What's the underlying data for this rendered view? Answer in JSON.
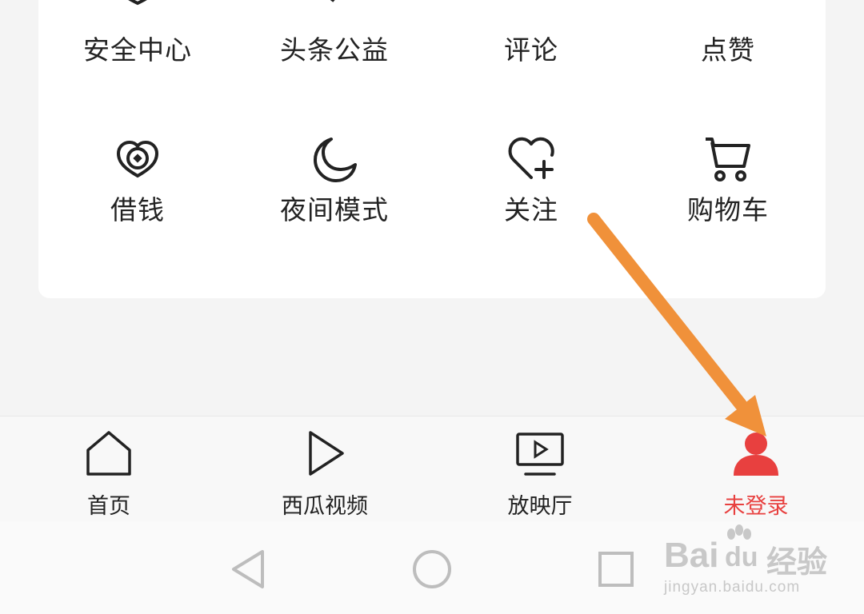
{
  "menu": {
    "row1": [
      {
        "label": "安全中心",
        "icon": "shield-icon"
      },
      {
        "label": "头条公益",
        "icon": "charity-icon"
      },
      {
        "label": "评论",
        "icon": "comment-icon"
      },
      {
        "label": "点赞",
        "icon": "like-icon"
      }
    ],
    "row2": [
      {
        "label": "借钱",
        "icon": "loan-icon"
      },
      {
        "label": "夜间模式",
        "icon": "moon-icon"
      },
      {
        "label": "关注",
        "icon": "heart-plus-icon"
      },
      {
        "label": "购物车",
        "icon": "cart-icon"
      }
    ]
  },
  "tabbar": {
    "items": [
      {
        "label": "首页",
        "icon": "home-icon"
      },
      {
        "label": "西瓜视频",
        "icon": "play-icon"
      },
      {
        "label": "放映厅",
        "icon": "tv-play-icon"
      },
      {
        "label": "未登录",
        "icon": "user-icon",
        "active": true
      }
    ]
  },
  "system_nav": {
    "icons": [
      "back-triangle-icon",
      "home-circle-icon",
      "recents-square-icon"
    ]
  },
  "watermark": {
    "brand": "Bai",
    "brand2": "du",
    "cn": "经验",
    "url": "jingyan.baidu.com"
  },
  "colors": {
    "accent": "#e8403f",
    "arrow": "#f0913a",
    "icon": "#222222"
  }
}
